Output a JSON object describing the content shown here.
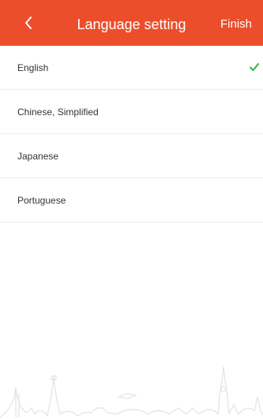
{
  "header": {
    "title": "Language setting",
    "finish_label": "Finish",
    "back_icon": "chevron-left-icon",
    "background_color": "#ec4e2c"
  },
  "languages": [
    {
      "label": "English",
      "selected": true
    },
    {
      "label": "Chinese, Simplified",
      "selected": false
    },
    {
      "label": "Japanese",
      "selected": false
    },
    {
      "label": "Portuguese",
      "selected": false
    }
  ],
  "colors": {
    "accent": "#ec4e2c",
    "check": "#3cb043"
  }
}
